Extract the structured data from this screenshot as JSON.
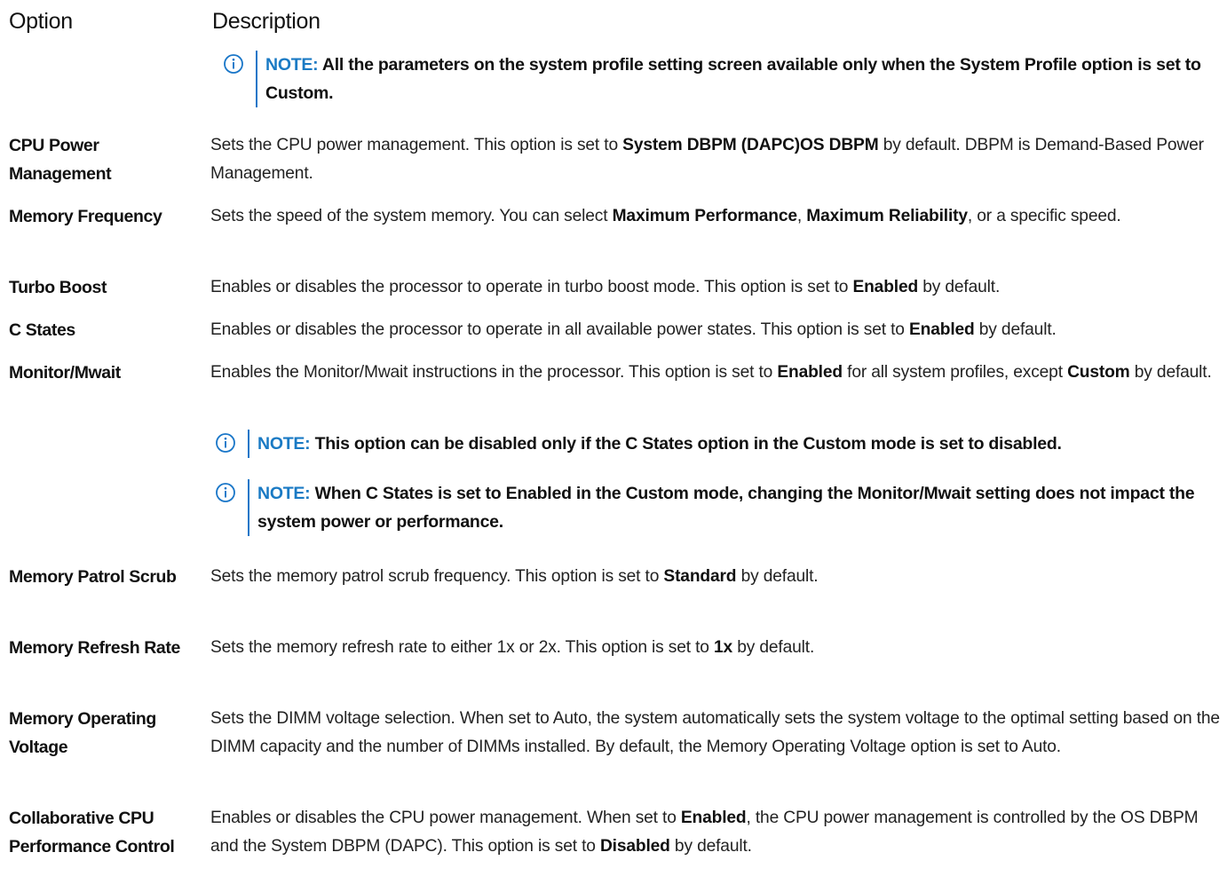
{
  "header": {
    "option": "Option",
    "description": "Description"
  },
  "top_note": {
    "label": "NOTE:",
    "text": "All the parameters on the system profile setting screen available only when the System Profile option is set to Custom."
  },
  "rows": [
    {
      "option": "CPU Power Management",
      "description": [
        {
          "t": "Sets the CPU power management. This option is set to "
        },
        {
          "t": "System DBPM (DAPC)OS DBPM",
          "b": true
        },
        {
          "t": " by default. DBPM is Demand-Based Power Management."
        }
      ]
    },
    {
      "option": "Memory Frequency",
      "description": [
        {
          "t": "Sets the speed of the system memory. You can select "
        },
        {
          "t": "Maximum Performance",
          "b": true
        },
        {
          "t": ", "
        },
        {
          "t": "Maximum Reliability",
          "b": true
        },
        {
          "t": ", or a specific speed."
        }
      ]
    },
    {
      "option": "Turbo Boost",
      "description": [
        {
          "t": "Enables or disables the processor to operate in turbo boost mode. This option is set to "
        },
        {
          "t": "Enabled",
          "b": true
        },
        {
          "t": " by default."
        }
      ]
    },
    {
      "option": "C States",
      "description": [
        {
          "t": "Enables or disables the processor to operate in all available power states. This option is set to "
        },
        {
          "t": "Enabled",
          "b": true
        },
        {
          "t": " by default."
        }
      ]
    },
    {
      "option": "Monitor/Mwait",
      "description": [
        {
          "t": "Enables the Monitor/Mwait instructions in the processor. This option is set to "
        },
        {
          "t": "Enabled",
          "b": true
        },
        {
          "t": " for all system profiles, except "
        },
        {
          "t": "Custom",
          "b": true
        },
        {
          "t": " by default."
        }
      ]
    },
    {
      "option": "Memory Patrol Scrub",
      "description": [
        {
          "t": "Sets the memory patrol scrub frequency. This option is set to "
        },
        {
          "t": "Standard",
          "b": true
        },
        {
          "t": " by default."
        }
      ]
    },
    {
      "option": "Memory Refresh Rate",
      "description": [
        {
          "t": "Sets the memory refresh rate to either 1x or 2x. This option is set to "
        },
        {
          "t": "1x",
          "b": true
        },
        {
          "t": " by default."
        }
      ]
    },
    {
      "option": "Memory Operating Voltage",
      "description": [
        {
          "t": "Sets the DIMM voltage selection. When set to Auto, the system automatically sets the system voltage to the optimal setting based on the DIMM capacity and the number of DIMMs installed. By default, the Memory Operating Voltage option is set to Auto."
        }
      ]
    },
    {
      "option": "Collaborative CPU Performance Control",
      "description": [
        {
          "t": "Enables or disables the CPU power management. When set to "
        },
        {
          "t": "Enabled",
          "b": true
        },
        {
          "t": ", the CPU power management is controlled by the OS DBPM and the System DBPM (DAPC). This option is set to "
        },
        {
          "t": "Disabled",
          "b": true
        },
        {
          "t": " by default."
        }
      ]
    }
  ],
  "monitor_notes": [
    {
      "label": "NOTE:",
      "text": "This option can be disabled only if the C States option in the Custom mode is set to disabled."
    },
    {
      "label": "NOTE:",
      "text": "When C States is set to Enabled in the Custom mode, changing the Monitor/Mwait setting does not impact the system power or performance."
    }
  ],
  "icon_name": "info-circle-icon",
  "colors": {
    "accent": "#1a7ac4",
    "note_bar": "#1976c8",
    "text": "#111111"
  }
}
